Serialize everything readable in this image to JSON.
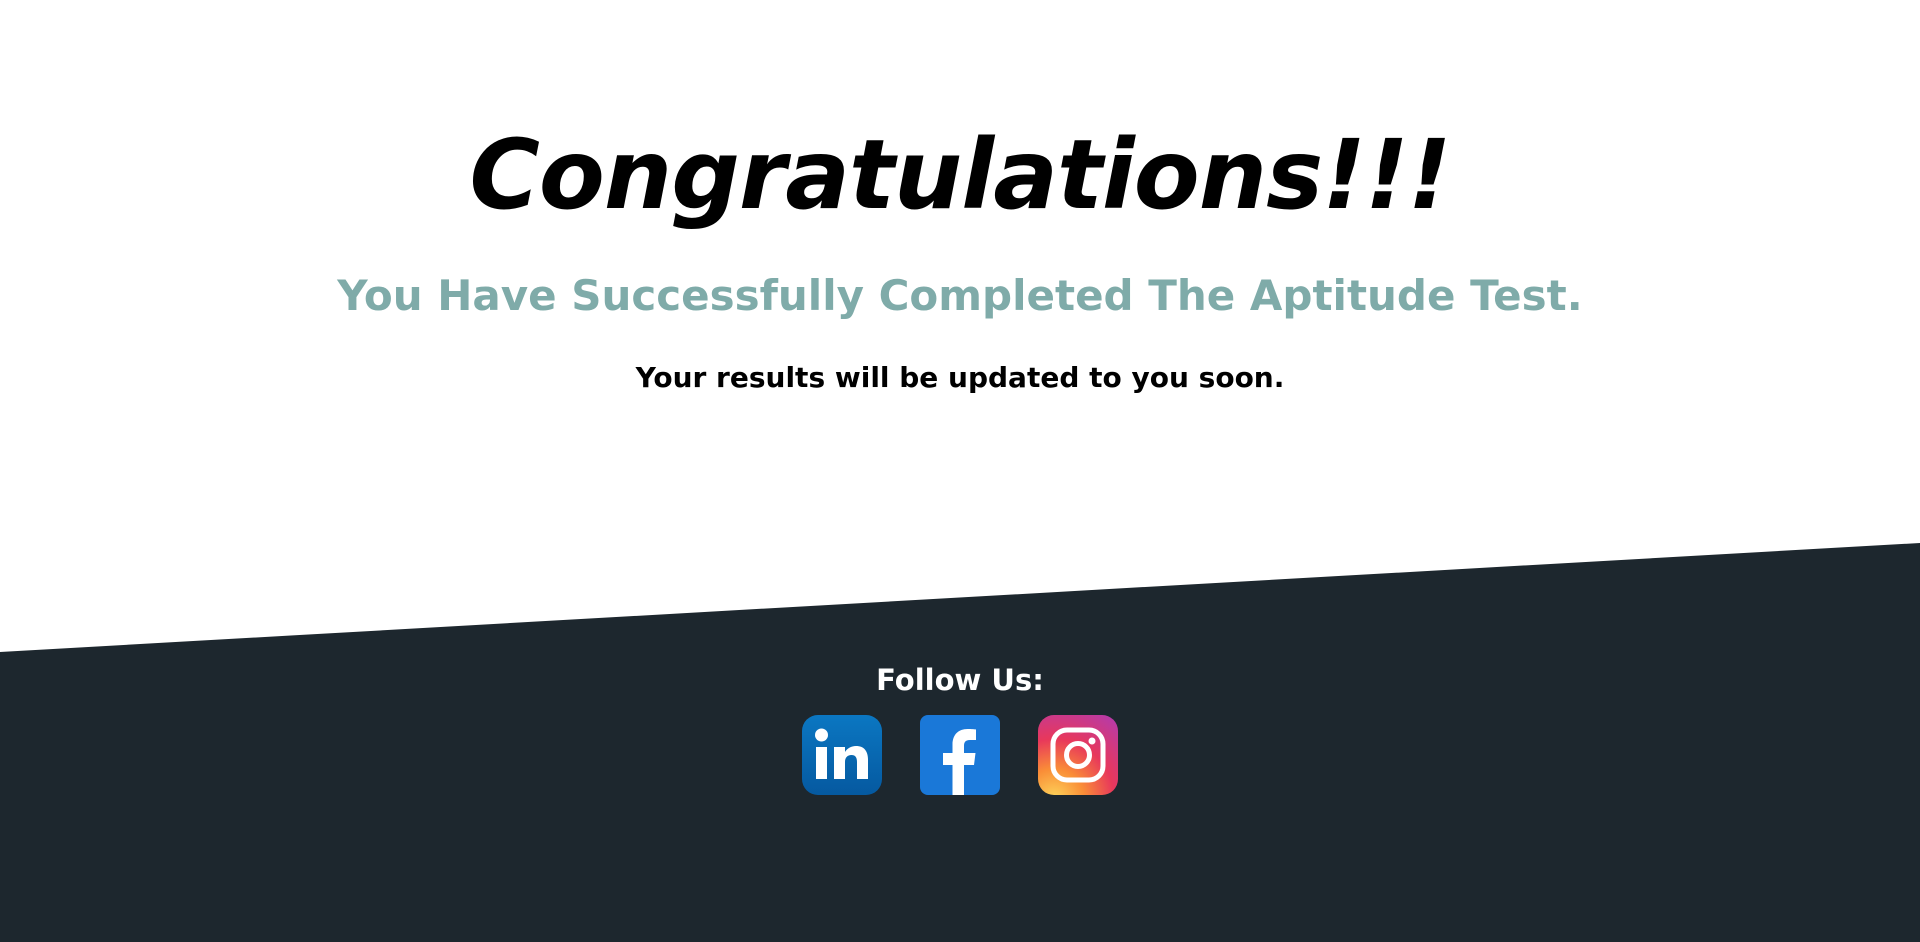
{
  "hero": {
    "title": "Congratulations!!!",
    "subtitle": "You Have Successfully Completed The Aptitude Test.",
    "message": "Your results will be updated to you soon."
  },
  "footer": {
    "follow_label": "Follow Us:",
    "socials": [
      {
        "icon": "linkedin-icon",
        "color": "#0a66c2"
      },
      {
        "icon": "facebook-icon",
        "color": "#1877f2"
      },
      {
        "icon": "instagram-icon",
        "color": "#e1306c"
      }
    ]
  },
  "colors": {
    "footer_bg": "#1d272e",
    "subtitle": "#7faba9",
    "title": "#000000",
    "background": "#ffffff"
  }
}
